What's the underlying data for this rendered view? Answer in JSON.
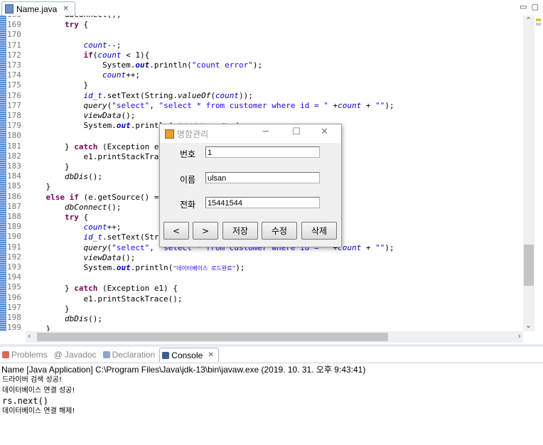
{
  "editor": {
    "tab_label": "Name.java",
    "tab_close": "✕",
    "line_numbers": [
      "168",
      "169",
      "170",
      "171",
      "172",
      "173",
      "174",
      "175",
      "176",
      "177",
      "178",
      "179",
      "180",
      "181",
      "182",
      "183",
      "184",
      "185",
      "186",
      "187",
      "188",
      "189",
      "190",
      "191",
      "192",
      "193",
      "194",
      "195",
      "196",
      "197",
      "198",
      "199"
    ]
  },
  "dialog": {
    "title": "명함관리",
    "fields": [
      {
        "label": "번호",
        "value": "1"
      },
      {
        "label": "이름",
        "value": "ulsan"
      },
      {
        "label": "전화",
        "value": "15441544"
      }
    ],
    "buttons": [
      "<",
      ">",
      "저장",
      "수정",
      "삭제"
    ]
  },
  "bottom_tabs": [
    "Problems",
    "Javadoc",
    "Declaration",
    "Console"
  ],
  "console": {
    "header": "Name [Java Application] C:\\Program Files\\Java\\jdk-13\\bin\\javaw.exe (2019. 10. 31. 오후 9:43:41)",
    "lines": [
      "드라이버 검색 성공!",
      "데이터베이스 연결 성공!",
      "rs.next()",
      "데이터베이스 연결 해제!"
    ]
  },
  "colors": {
    "keyword": "#7f0055",
    "string": "#2a00ff",
    "field": "#0000c0",
    "change_bar": "#5a8ad6"
  }
}
